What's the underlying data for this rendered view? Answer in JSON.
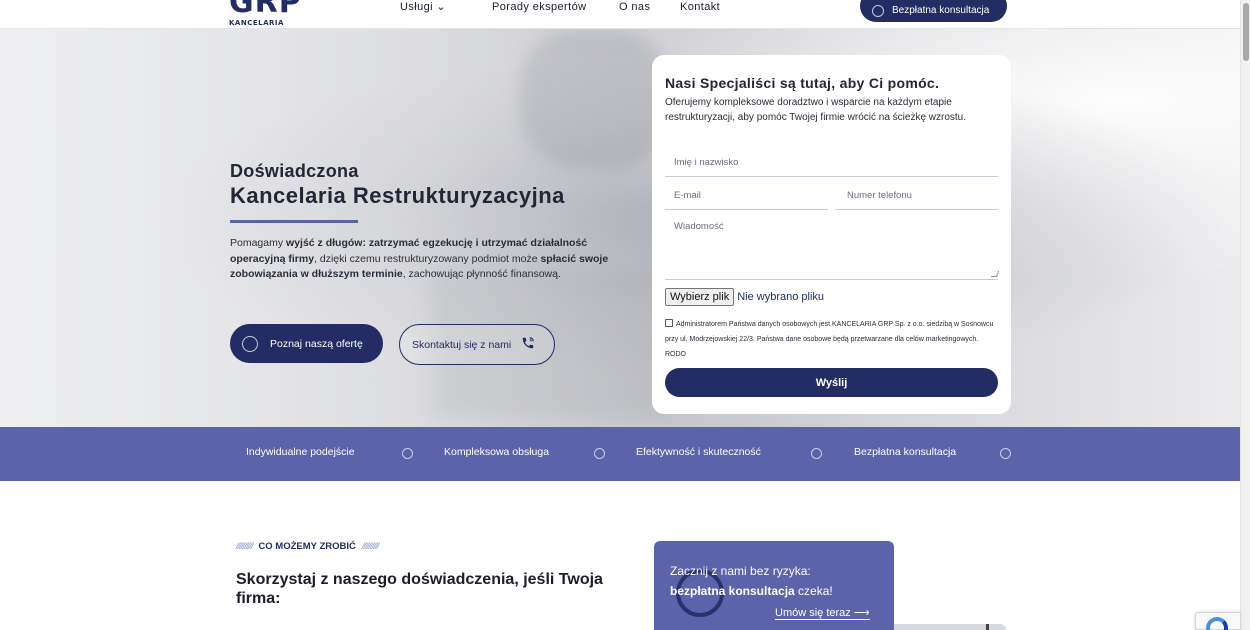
{
  "brand": {
    "logo_big": "GRP",
    "logo_small": "KANCELARIA"
  },
  "nav": {
    "items": [
      {
        "label": "Usługi ⌄"
      },
      {
        "label": "Porady ekspertów"
      },
      {
        "label": "O nas"
      },
      {
        "label": "Kontakt"
      }
    ],
    "cta_label": "Bezpłatna konsultacja"
  },
  "hero": {
    "title_small": "Doświadczona",
    "title_big": "Kancelaria Restrukturyzacyjna",
    "text_parts": {
      "p1": "Pomagamy ",
      "b1": "wyjść z długów: zatrzymać egzekucję i utrzymać działalność operacyjną firmy",
      "p2": ", dzięki czemu restrukturyzowany podmiot może ",
      "b2": "spłacić swoje zobowiązania w dłuższym terminie",
      "p3": ", zachowując płynność finansową."
    },
    "primary_button": "Poznaj naszą ofertę",
    "secondary_button": "Skontaktuj się z nami"
  },
  "form": {
    "title": "Nasi Specjaliści są tutaj, aby Ci pomóc.",
    "description": "Oferujemy kompleksowe doradztwo i wsparcie na każdym etapie restrukturyzacji, aby pomóc Twojej firmie wrócić na ścieżkę wzrostu.",
    "name_placeholder": "Imię i nazwisko",
    "email_placeholder": "E-mail",
    "phone_placeholder": "Numer telefonu",
    "message_placeholder": "Wiadomość",
    "file_button": "Wybierz plik",
    "file_status": "Nie wybrano pliku",
    "consent_text": "Administratorem Państwa danych osobowych jest KANCELARIA GRP Sp. z o.o. siedzibą w Sosnowcu przy ul. Modrzejowskiej 22/3. Państwa dane osobowe będą przetwarzane dla celów marketingowych. RODO",
    "submit": "Wyślij"
  },
  "features": [
    "Indywidualne podejście",
    "Kompleksowa obsługa",
    "Efektywność i skuteczność",
    "Bezpłatna konsultacja"
  ],
  "section": {
    "eyebrow_slashes": "//////////",
    "eyebrow": "CO MOŻEMY ZROBIĆ",
    "title": "Skorzystaj z naszego doświadczenia, jeśli Twoja firma:"
  },
  "promo": {
    "line1": "Zacznij z nami bez ryzyka:",
    "line2_bold": "bezpłatna konsultacja",
    "line2_rest": " czeka!",
    "link": "Umów się teraz ⟶"
  },
  "colors": {
    "navy": "#232c63",
    "accent": "#5d63aa"
  }
}
